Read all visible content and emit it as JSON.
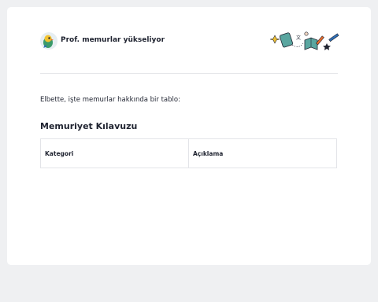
{
  "header": {
    "brand_name": "Prof. memurlar yükseliyor",
    "avatar_icon": "parrot-avatar-icon",
    "illustration_icon": "decorative-doodle-icon"
  },
  "content": {
    "intro_text": "Elbette, işte memurlar hakkında bir tablo:",
    "section_title": "Memuriyet Kılavuzu",
    "table": {
      "headers": [
        "Kategori",
        "Açıklama"
      ]
    }
  },
  "colors": {
    "background": "#eff0f2",
    "card": "#ffffff",
    "text": "#1f2330",
    "border": "#e3e4e8"
  }
}
